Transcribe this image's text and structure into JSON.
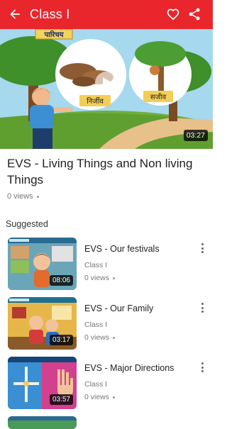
{
  "header": {
    "title": "Class I",
    "back_icon": "arrow-left-icon",
    "favorite_icon": "heart-outline-icon",
    "share_icon": "share-icon"
  },
  "video": {
    "duration": "03:27",
    "thumbnail_text": {
      "banner": "पारिचय",
      "left_card": "निर्जीव",
      "right_card": "सजीव"
    }
  },
  "details": {
    "title": "EVS - Living Things and Non living Things",
    "views": "0 views"
  },
  "suggested": {
    "label": "Suggested",
    "items": [
      {
        "title": "EVS - Our festivals",
        "subtitle": "Class I",
        "views": "0 views",
        "duration": "08:06"
      },
      {
        "title": "EVS - Our Family",
        "subtitle": "Class I",
        "views": "0 views",
        "duration": "03:17"
      },
      {
        "title": "EVS - Major Directions",
        "subtitle": "Class I",
        "views": "0 views",
        "duration": "03:57"
      }
    ]
  },
  "colors": {
    "primary": "#e8262b",
    "text": "#222222",
    "secondary_text": "#777777"
  }
}
